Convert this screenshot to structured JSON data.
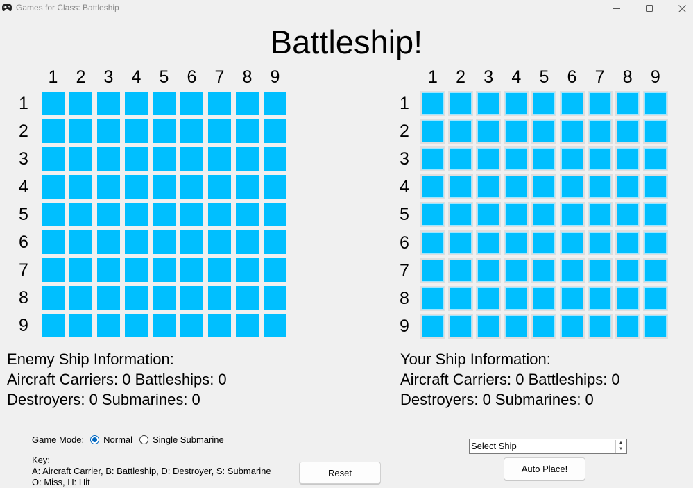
{
  "window": {
    "title": "Games for Class: Battleship",
    "app_icon": "gamepad-icon",
    "controls": [
      "minimize-icon",
      "maximize-icon",
      "close-icon"
    ]
  },
  "header": {
    "title": "Battleship!"
  },
  "enemy_board": {
    "columns": [
      "1",
      "2",
      "3",
      "4",
      "5",
      "6",
      "7",
      "8",
      "9"
    ],
    "rows": [
      "1",
      "2",
      "3",
      "4",
      "5",
      "6",
      "7",
      "8",
      "9"
    ],
    "cell_color": "#00bfff"
  },
  "player_board": {
    "columns": [
      "1",
      "2",
      "3",
      "4",
      "5",
      "6",
      "7",
      "8",
      "9"
    ],
    "rows": [
      "1",
      "2",
      "3",
      "4",
      "5",
      "6",
      "7",
      "8",
      "9"
    ],
    "cell_color": "#00bfff"
  },
  "enemy_info": {
    "heading": "Enemy Ship Information:",
    "line1": "Aircraft Carriers: 0 Battleships: 0",
    "line2": "Destroyers: 0 Submarines: 0"
  },
  "player_info": {
    "heading": "Your Ship Information:",
    "line1": "Aircraft Carriers: 0 Battleships: 0",
    "line2": "Destroyers: 0 Submarines: 0"
  },
  "game_mode": {
    "label": "Game Mode:",
    "options": [
      {
        "label": "Normal",
        "selected": true
      },
      {
        "label": "Single Submarine",
        "selected": false
      }
    ]
  },
  "key": {
    "title": "Key:",
    "line1": "A: Aircraft Carrier, B: Battleship, D: Destroyer, S: Submarine",
    "line2": "O: Miss, H: Hit"
  },
  "controls": {
    "reset_label": "Reset",
    "ship_select_value": "Select Ship",
    "auto_place_label": "Auto Place!"
  },
  "colors": {
    "accent": "#0067c0",
    "water": "#00bfff",
    "background": "#f0f0f0"
  }
}
